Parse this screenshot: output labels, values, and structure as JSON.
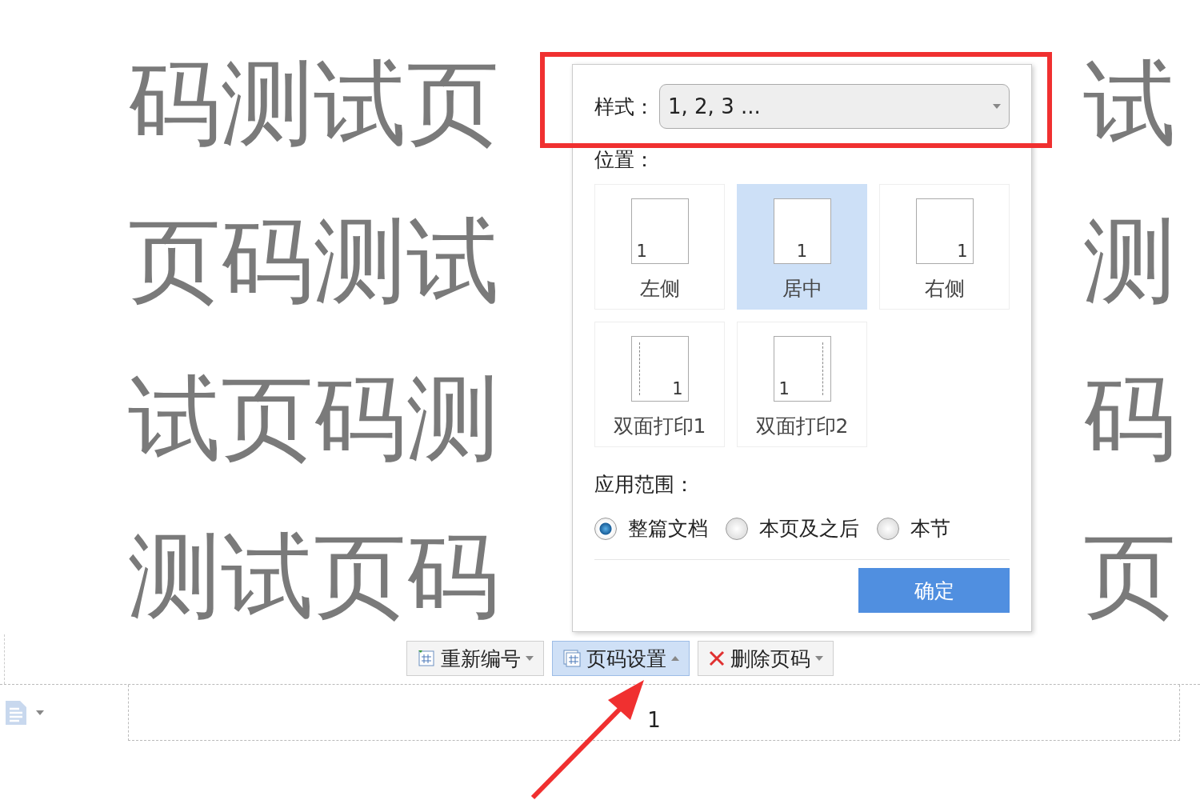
{
  "background_text": [
    {
      "left": "码测试页",
      "right": "试"
    },
    {
      "left": "页码测试",
      "right": "测"
    },
    {
      "left": "试页码测",
      "right": "码"
    },
    {
      "left": "测试页码",
      "right": "页"
    }
  ],
  "popup": {
    "style_label": "样式：",
    "style_value": "1, 2, 3 ...",
    "position_label": "位置：",
    "positions": [
      {
        "label": "左侧",
        "number": "1",
        "kind": "left",
        "selected": false
      },
      {
        "label": "居中",
        "number": "1",
        "kind": "center",
        "selected": true
      },
      {
        "label": "右侧",
        "number": "1",
        "kind": "right",
        "selected": false
      },
      {
        "label": "双面打印1",
        "number": "1",
        "kind": "outer",
        "selected": false
      },
      {
        "label": "双面打印2",
        "number": "1",
        "kind": "inner",
        "selected": false
      }
    ],
    "scope_label": "应用范围：",
    "scopes": [
      {
        "label": "整篇文档",
        "selected": true
      },
      {
        "label": "本页及之后",
        "selected": false
      },
      {
        "label": "本节",
        "selected": false
      }
    ],
    "confirm": "确定"
  },
  "toolbar": [
    {
      "label": "重新编号",
      "kind": "renumber",
      "expanded": false
    },
    {
      "label": "页码设置",
      "kind": "settings",
      "expanded": true
    },
    {
      "label": "删除页码",
      "kind": "delete",
      "expanded": false
    }
  ],
  "footer": {
    "page_number": "1"
  }
}
